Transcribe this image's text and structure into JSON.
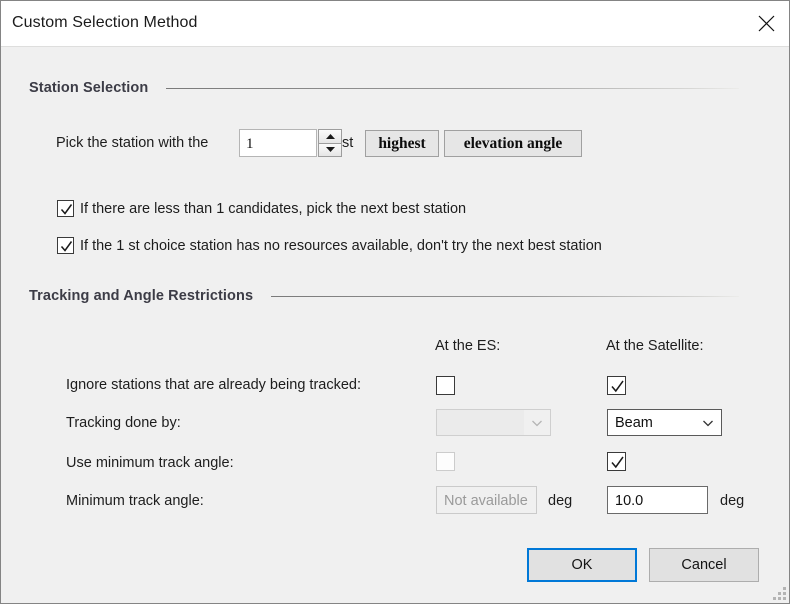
{
  "window": {
    "title": "Custom Selection Method",
    "close_icon": "close-icon",
    "resize_grip": "resize-grip"
  },
  "station_section": {
    "heading": "Station Selection",
    "pick_label": "Pick the station with the",
    "spinner_value": "1",
    "ordinal_suffix": "st",
    "rank_button": "highest",
    "criterion_button": "elevation angle",
    "checkbox_1": {
      "label": "If there are less than 1 candidates, pick the next best station",
      "checked": true
    },
    "checkbox_2": {
      "label": "If the 1 st choice station has no resources available, don't try the next best station",
      "checked": true
    }
  },
  "tracking_section": {
    "heading": "Tracking and Angle Restrictions",
    "col_es": "At the ES:",
    "col_sat": "At the Satellite:",
    "rows": [
      {
        "label": "Ignore stations that are already being tracked:",
        "es_checked": false,
        "sat_checked": true
      },
      {
        "label": "Tracking done by:",
        "es_value": "",
        "sat_value": "Beam"
      },
      {
        "label": "Use minimum track angle:",
        "es_checked": false,
        "sat_checked": true
      },
      {
        "label": "Minimum track angle:",
        "es_value": "Not available",
        "es_unit": "deg",
        "sat_value": "10.0",
        "sat_unit": "deg"
      }
    ]
  },
  "footer": {
    "ok_label": "OK",
    "cancel_label": "Cancel"
  },
  "colors": {
    "dialog_bg": "#f0f0f0",
    "titlebar_bg": "#ffffff",
    "accent_focus": "#0078d7",
    "heading_text": "#3c3c46",
    "disabled_text": "#9a9a9a"
  }
}
